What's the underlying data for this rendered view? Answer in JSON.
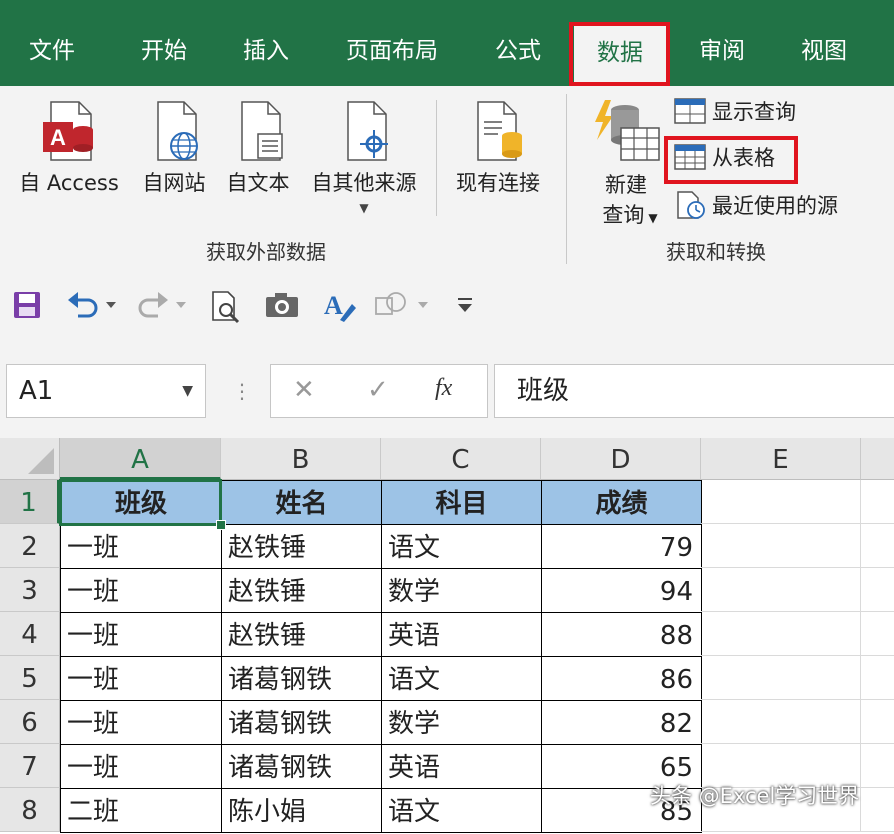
{
  "tabs": [
    "文件",
    "开始",
    "插入",
    "页面布局",
    "公式",
    "数据",
    "审阅",
    "视图"
  ],
  "active_tab": "数据",
  "ribbon": {
    "external_group": {
      "label": "获取外部数据",
      "buttons": [
        "自 Access",
        "自网站",
        "自文本",
        "自其他来源",
        "现有连接"
      ]
    },
    "transform_group": {
      "label": "获取和转换",
      "new_query": [
        "新建",
        "查询"
      ],
      "show_queries": "显示查询",
      "from_table": "从表格",
      "recent_sources": "最近使用的源"
    }
  },
  "formula_bar": {
    "name_box": "A1",
    "fx": "fx",
    "formula": "班级"
  },
  "columns": [
    "A",
    "B",
    "C",
    "D",
    "E"
  ],
  "rows": [
    "1",
    "2",
    "3",
    "4",
    "5",
    "6",
    "7",
    "8"
  ],
  "table": {
    "headers": [
      "班级",
      "姓名",
      "科目",
      "成绩"
    ],
    "data": [
      [
        "一班",
        "赵铁锤",
        "语文",
        "79"
      ],
      [
        "一班",
        "赵铁锤",
        "数学",
        "94"
      ],
      [
        "一班",
        "赵铁锤",
        "英语",
        "88"
      ],
      [
        "一班",
        "诸葛钢铁",
        "语文",
        "86"
      ],
      [
        "一班",
        "诸葛钢铁",
        "数学",
        "82"
      ],
      [
        "一班",
        "诸葛钢铁",
        "英语",
        "65"
      ],
      [
        "二班",
        "陈小娟",
        "语文",
        "85"
      ]
    ]
  },
  "watermark": "头条 @Excel学习世界",
  "colors": {
    "excel_green": "#217346",
    "header_fill": "#9dc3e6",
    "highlight_red": "#e0141e"
  }
}
